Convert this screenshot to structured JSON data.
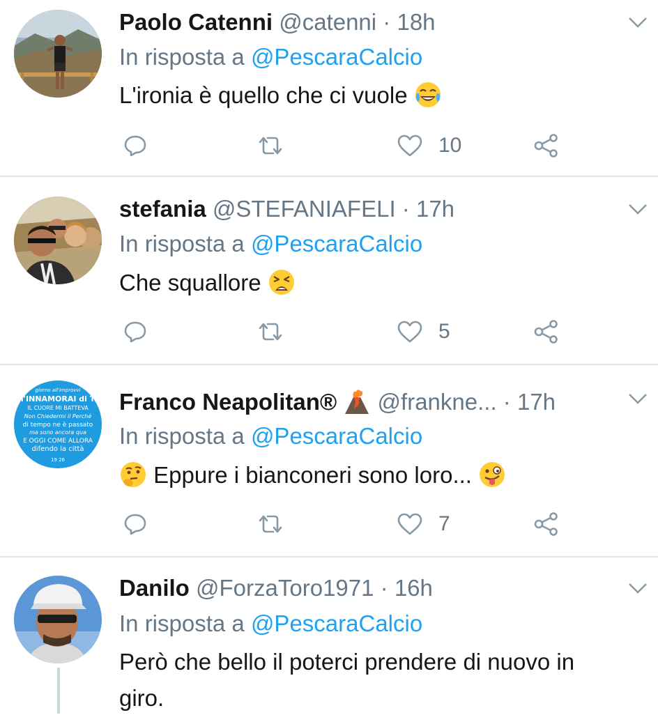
{
  "colors": {
    "accent": "#1da1f2",
    "secondary": "#657786",
    "divider": "#e1e8ed",
    "text": "#14171a"
  },
  "tweets": [
    {
      "name": "Paolo Catenni",
      "handle": "@catenni",
      "time": "18h",
      "reply_prefix": "In risposta a",
      "reply_to": "@PescaraCalcio",
      "text": "L'ironia è quello che ci vuole",
      "emoji": "face-with-tears-of-joy",
      "likes": "10"
    },
    {
      "name": "stefania",
      "handle": "@STEFANIAFELI",
      "time": "17h",
      "reply_prefix": "In risposta a",
      "reply_to": "@PescaraCalcio",
      "text": "Che squallore",
      "emoji": "weary-face",
      "likes": "5"
    },
    {
      "name": "Franco Neapolitan®",
      "handle": "@frankne...",
      "time": "17h",
      "reply_prefix": "In risposta a",
      "reply_to": "@PescaraCalcio",
      "text": "Eppure i bianconeri sono loro...",
      "emoji_before": "thinking-face",
      "emoji": "winking-face-with-tongue",
      "name_emoji": "volcano",
      "likes": "7",
      "avatar_text": [
        "giorno all'improvvi",
        "m'INNAMORAI di TE",
        "IL CUORE MI BATTEVA",
        "Non Chiedermi il Perché",
        "di tempo ne è passato",
        "ma sono ancora qua",
        "E OGGI COME ALLORA",
        "difendo la città",
        "19 26"
      ]
    },
    {
      "name": "Danilo",
      "handle": "@ForzaToro1971",
      "time": "16h",
      "reply_prefix": "In risposta a",
      "reply_to": "@PescaraCalcio",
      "text_line1": "Però che bello il poterci prendere di nuovo in",
      "text_line2": "giro."
    }
  ]
}
